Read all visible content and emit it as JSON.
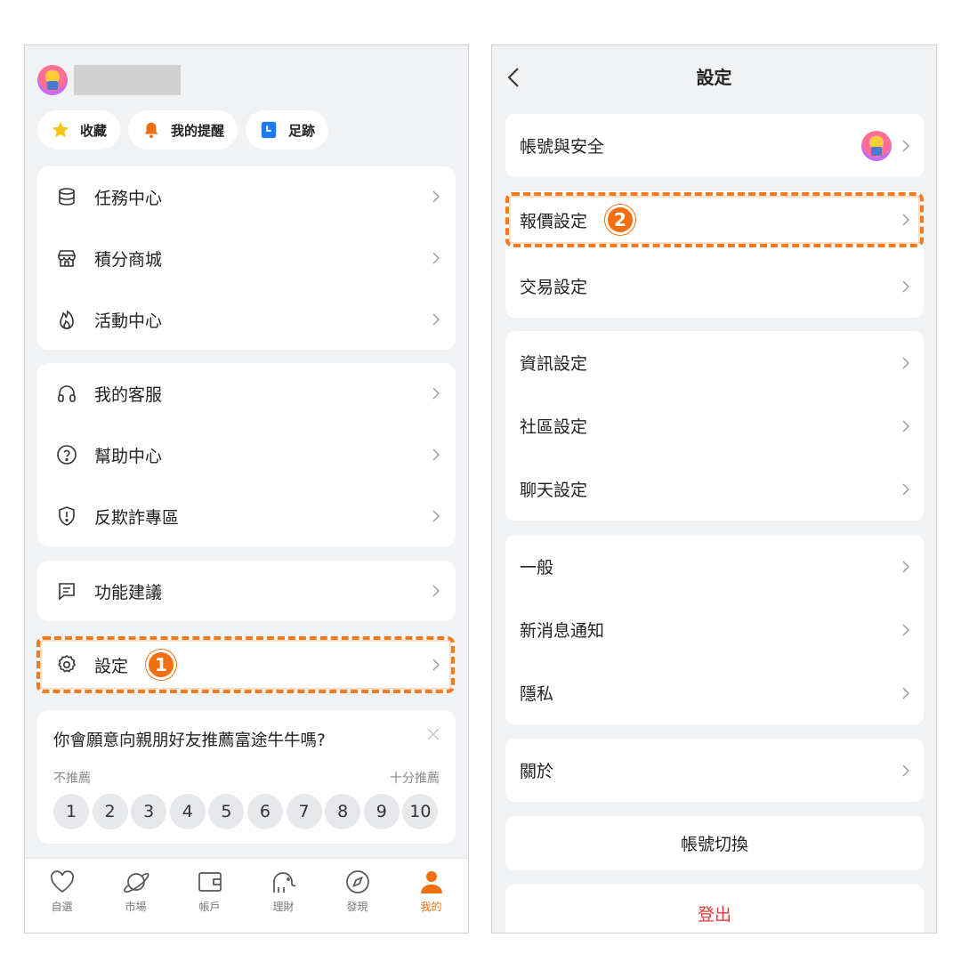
{
  "left": {
    "quick_links": [
      {
        "label": "收藏",
        "icon": "star-icon"
      },
      {
        "label": "我的提醒",
        "icon": "bell-icon"
      },
      {
        "label": "足跡",
        "icon": "footprint-icon"
      }
    ],
    "menu_group1": [
      {
        "label": "任務中心",
        "icon": "database-icon"
      },
      {
        "label": "積分商城",
        "icon": "store-icon"
      },
      {
        "label": "活動中心",
        "icon": "flame-icon"
      }
    ],
    "menu_group2": [
      {
        "label": "我的客服",
        "icon": "headset-icon"
      },
      {
        "label": "幫助中心",
        "icon": "question-icon"
      },
      {
        "label": "反欺詐專區",
        "icon": "shield-alert-icon"
      }
    ],
    "menu_group3": [
      {
        "label": "功能建議",
        "icon": "message-icon"
      }
    ],
    "settings": {
      "label": "設定",
      "icon": "gear-icon",
      "step_badge": "1"
    },
    "survey": {
      "question": "你會願意向親朋好友推薦富途牛牛嗎?",
      "low_label": "不推薦",
      "high_label": "十分推薦",
      "scale": [
        "1",
        "2",
        "3",
        "4",
        "5",
        "6",
        "7",
        "8",
        "9",
        "10"
      ]
    },
    "tabs": [
      {
        "label": "自選",
        "icon": "heart-icon"
      },
      {
        "label": "市場",
        "icon": "planet-icon"
      },
      {
        "label": "帳戶",
        "icon": "wallet-icon"
      },
      {
        "label": "理財",
        "icon": "elephant-icon"
      },
      {
        "label": "發現",
        "icon": "compass-icon"
      },
      {
        "label": "我的",
        "icon": "person-icon",
        "active": true
      }
    ],
    "accent_color": "#f26f10"
  },
  "right": {
    "title": "設定",
    "group1": [
      {
        "label": "帳號與安全"
      }
    ],
    "group2": [
      {
        "label": "報價設定",
        "step_badge": "2"
      },
      {
        "label": "交易設定"
      }
    ],
    "group3": [
      {
        "label": "資訊設定"
      },
      {
        "label": "社區設定"
      },
      {
        "label": "聊天設定"
      }
    ],
    "group4": [
      {
        "label": "一般"
      },
      {
        "label": "新消息通知"
      },
      {
        "label": "隱私"
      }
    ],
    "group5": [
      {
        "label": "關於"
      }
    ],
    "switch_account": "帳號切換",
    "logout": "登出",
    "logout_color": "#e53935"
  }
}
